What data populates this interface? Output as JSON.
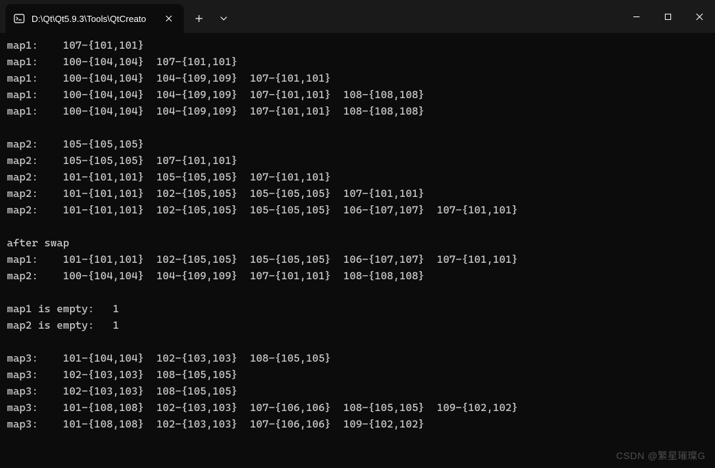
{
  "titlebar": {
    "tab_title": "D:\\Qt\\Qt5.9.3\\Tools\\QtCreato",
    "tab_icon_name": "terminal-icon"
  },
  "terminal": {
    "lines": [
      "map1:    107-{101,101}",
      "map1:    100-{104,104}  107-{101,101}",
      "map1:    100-{104,104}  104-{109,109}  107-{101,101}",
      "map1:    100-{104,104}  104-{109,109}  107-{101,101}  108-{108,108}",
      "map1:    100-{104,104}  104-{109,109}  107-{101,101}  108-{108,108}",
      "",
      "map2:    105-{105,105}",
      "map2:    105-{105,105}  107-{101,101}",
      "map2:    101-{101,101}  105-{105,105}  107-{101,101}",
      "map2:    101-{101,101}  102-{105,105}  105-{105,105}  107-{101,101}",
      "map2:    101-{101,101}  102-{105,105}  105-{105,105}  106-{107,107}  107-{101,101}",
      "",
      "after swap",
      "map1:    101-{101,101}  102-{105,105}  105-{105,105}  106-{107,107}  107-{101,101}",
      "map2:    100-{104,104}  104-{109,109}  107-{101,101}  108-{108,108}",
      "",
      "map1 is empty:   1",
      "map2 is empty:   1",
      "",
      "map3:    101-{104,104}  102-{103,103}  108-{105,105}",
      "map3:    102-{103,103}  108-{105,105}",
      "map3:    102-{103,103}  108-{105,105}",
      "map3:    101-{108,108}  102-{103,103}  107-{106,106}  108-{105,105}  109-{102,102}",
      "map3:    101-{108,108}  102-{103,103}  107-{106,106}  109-{102,102}"
    ]
  },
  "watermark": "CSDN @繁星璀璨G"
}
